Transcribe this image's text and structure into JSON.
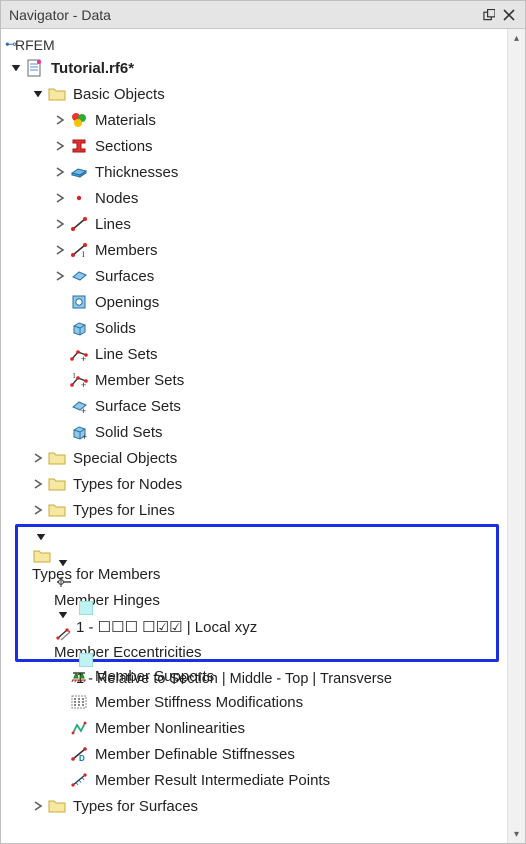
{
  "titlebar": {
    "title": "Navigator - Data"
  },
  "root": {
    "app": "RFEM"
  },
  "file": {
    "name": "Tutorial.rf6*"
  },
  "basicObjects": {
    "label": "Basic Objects",
    "materials": "Materials",
    "sections": "Sections",
    "thicknesses": "Thicknesses",
    "nodes": "Nodes",
    "lines": "Lines",
    "members": "Members",
    "surfaces": "Surfaces",
    "openings": "Openings",
    "solids": "Solids",
    "lineSets": "Line Sets",
    "memberSets": "Member Sets",
    "surfaceSets": "Surface Sets",
    "solidSets": "Solid Sets"
  },
  "specialObjects": {
    "label": "Special Objects"
  },
  "typesForNodes": {
    "label": "Types for Nodes"
  },
  "typesForLines": {
    "label": "Types for Lines"
  },
  "typesForMembers": {
    "label": "Types for Members",
    "memberHinges": {
      "label": "Member Hinges",
      "item1": "1 - ☐☐☐ ☐☑☑ | Local xyz"
    },
    "memberEccentricities": {
      "label": "Member Eccentricities",
      "item1": "1 - Relative to Section | Middle - Top | Transverse"
    },
    "memberSupports": "Member Supports",
    "memberStiffnessMods": "Member Stiffness Modifications",
    "memberNonlinearities": "Member Nonlinearities",
    "memberDefStiffnesses": "Member Definable Stiffnesses",
    "memberResultIntPoints": "Member Result Intermediate Points"
  },
  "typesForSurfaces": {
    "label": "Types for Surfaces"
  }
}
